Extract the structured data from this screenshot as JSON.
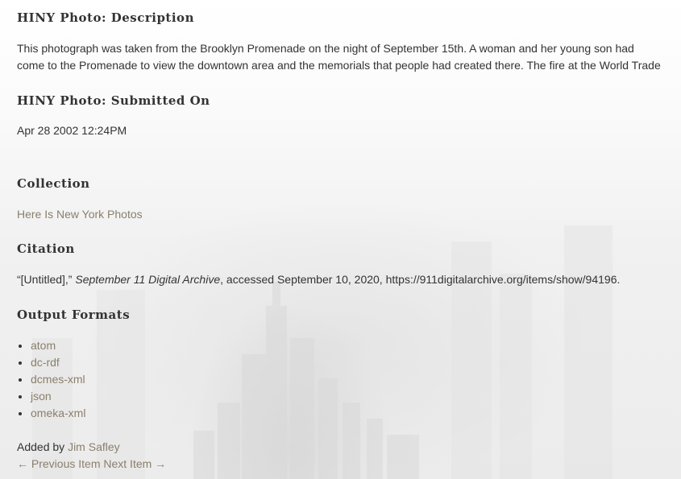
{
  "description": {
    "heading": "HINY Photo: Description",
    "text": "This photograph was taken from the Brooklyn Promenade on the night of September 15th. A woman and her young son had come to the Promenade to view the downtown area and the memorials that people had created there. The fire at the World Trade Center was s"
  },
  "submitted": {
    "heading": "HINY Photo: Submitted On",
    "value": "Apr 28 2002 12:24PM"
  },
  "collection": {
    "heading": "Collection",
    "link": "Here Is New York Photos"
  },
  "citation": {
    "heading": "Citation",
    "prefix": "“[Untitled],”",
    "archive": "September 11 Digital Archive",
    "suffix": ", accessed September 10, 2020, https://911digitalarchive.org/items/show/94196."
  },
  "output_formats": {
    "heading": "Output Formats",
    "items": [
      "atom",
      "dc-rdf",
      "dcmes-xml",
      "json",
      "omeka-xml"
    ]
  },
  "added_by": {
    "label": "Added by",
    "name": "Jim Safley"
  },
  "pagination": {
    "previous": "← Previous Item",
    "next": "Next Item →"
  }
}
